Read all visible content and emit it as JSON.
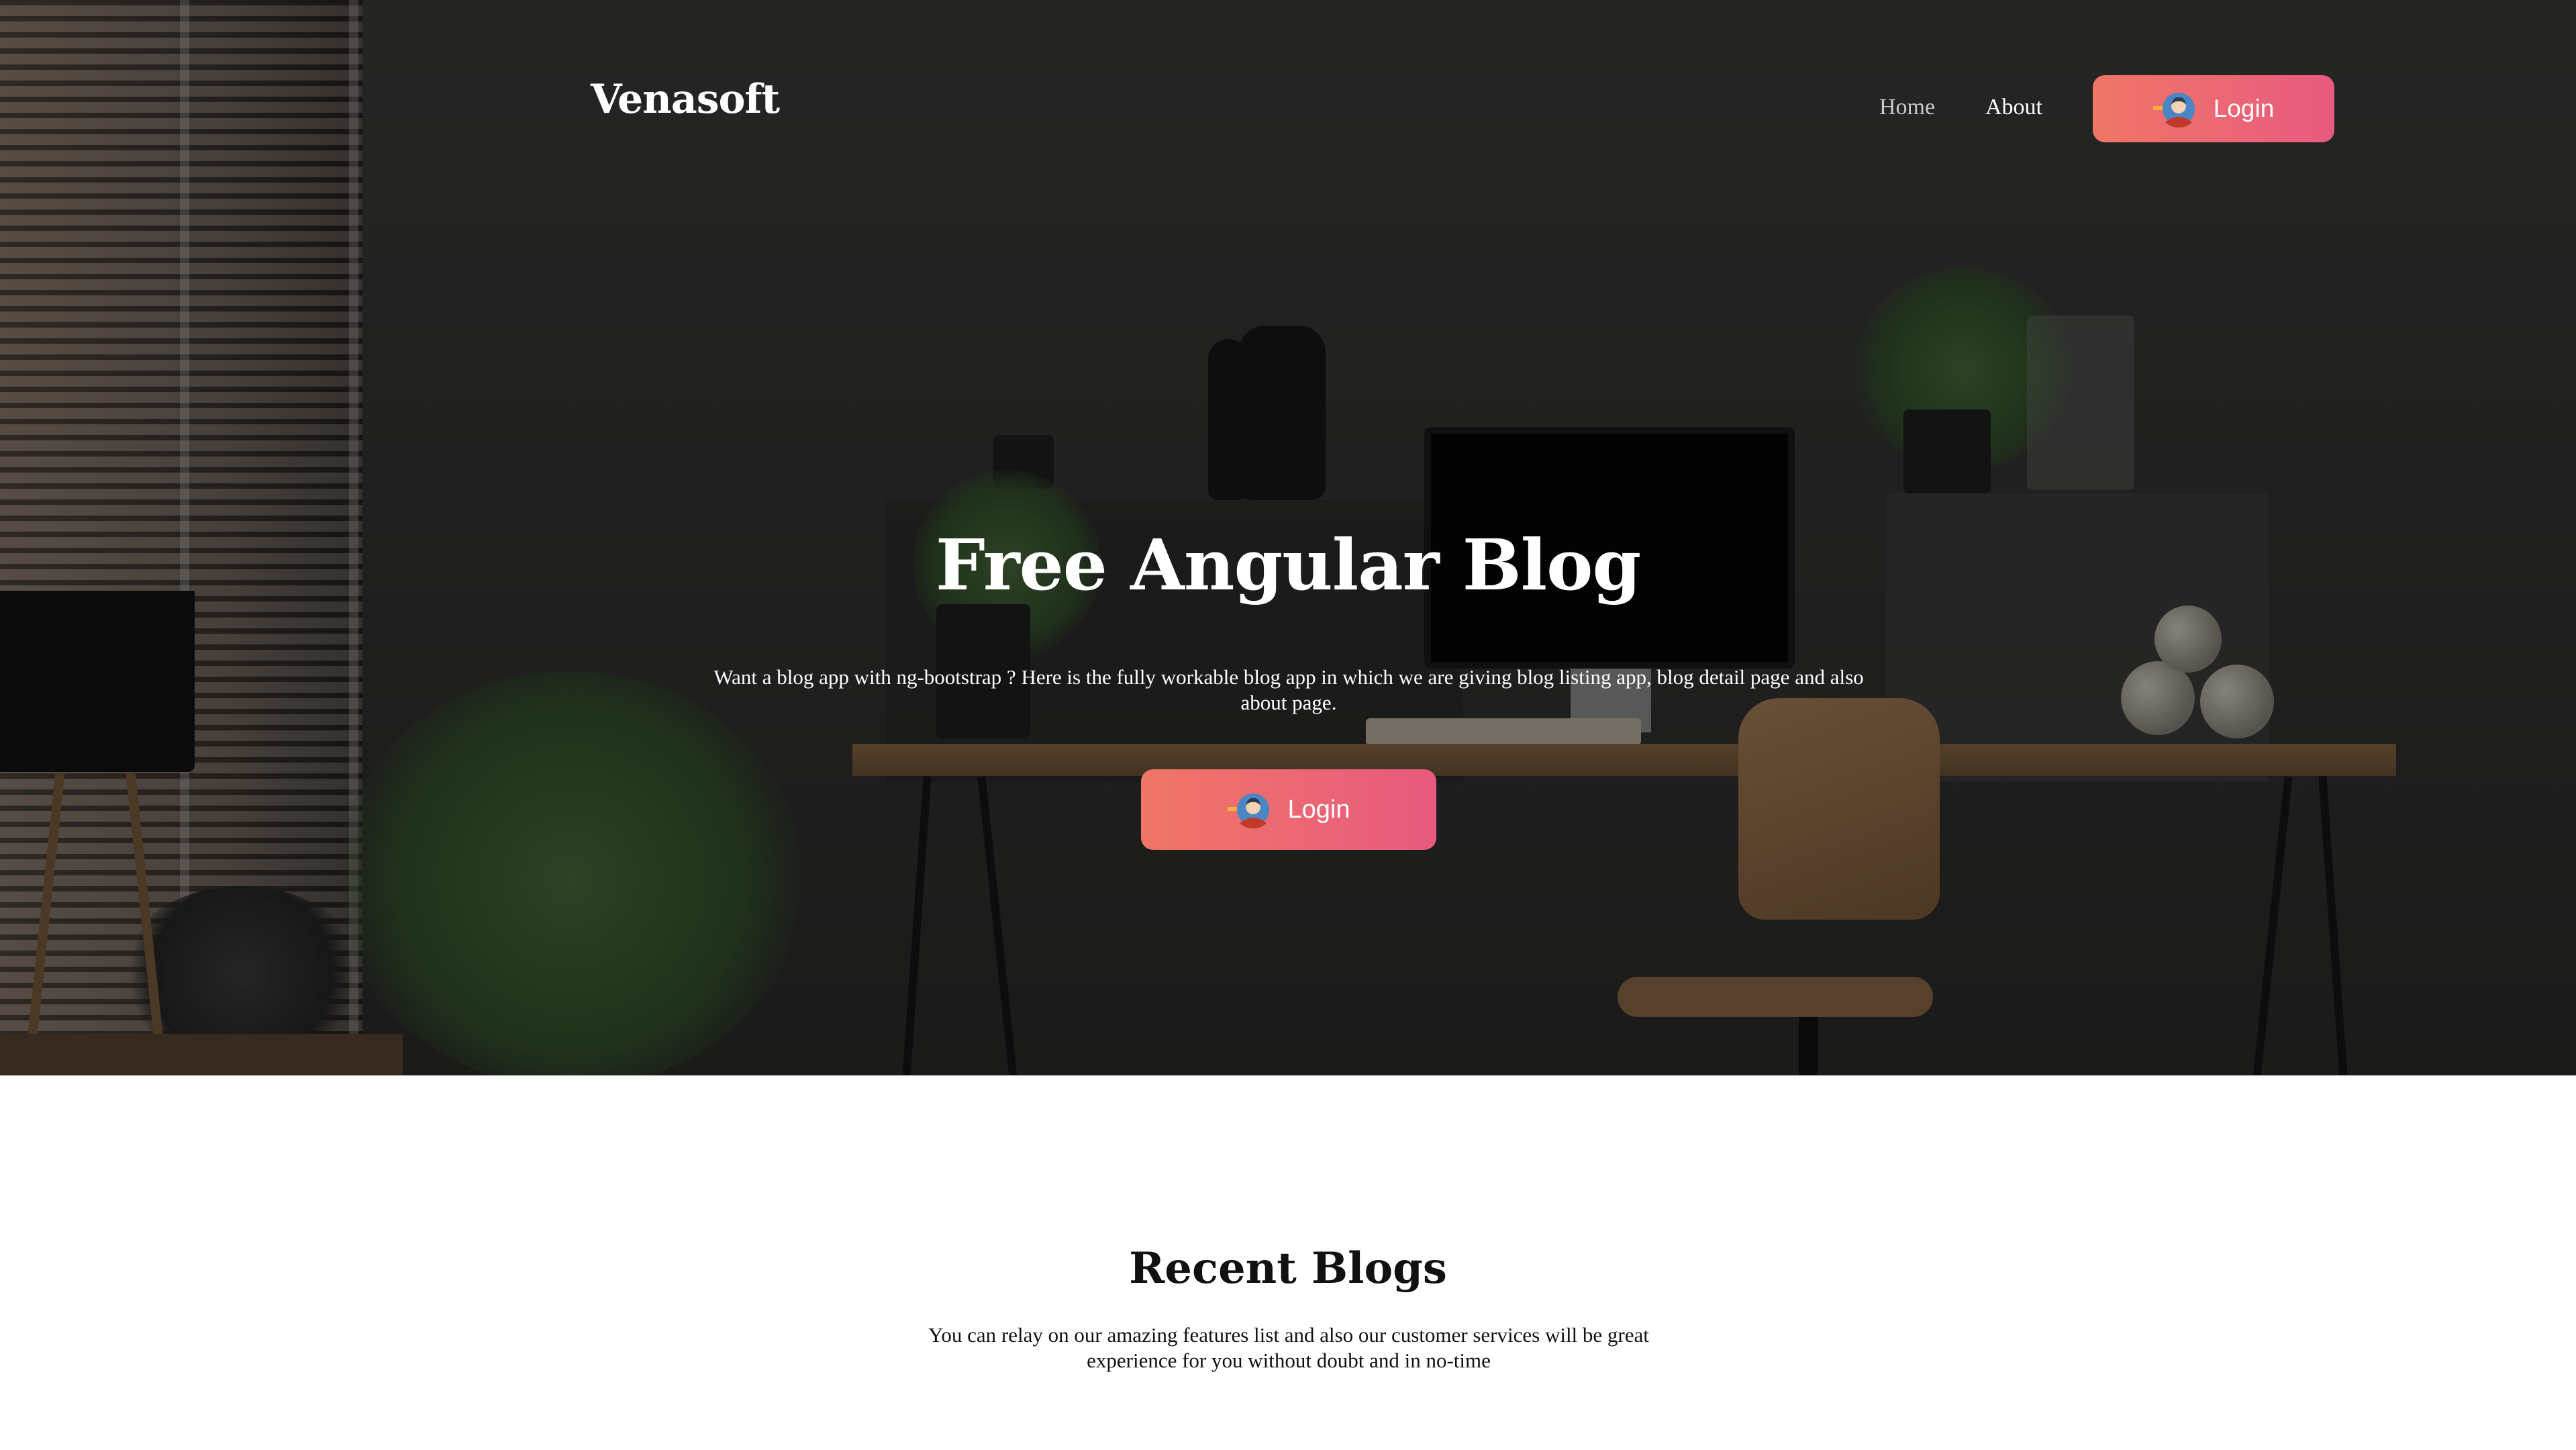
{
  "nav": {
    "brand": "Venasoft",
    "links": [
      {
        "label": "Home"
      },
      {
        "label": "About"
      }
    ],
    "login_label": "Login"
  },
  "hero": {
    "title": "Free Angular Blog",
    "description": "Want a blog app with ng-bootstrap ? Here is the fully workable blog app in which we are giving blog listing app, blog detail page and also about page.",
    "login_label": "Login",
    "background": "dark home office desk scene",
    "icon": "login-avatar-icon"
  },
  "recent": {
    "title": "Recent Blogs",
    "description": "You can relay on our amazing features list and also our customer services will be great experience for you without doubt and in no-time"
  },
  "colors": {
    "button_gradient_start": "#f07666",
    "button_gradient_end": "#e85a80",
    "nav_home": "#c9c9c9",
    "text_white": "#ffffff",
    "text_dark": "#111111"
  }
}
